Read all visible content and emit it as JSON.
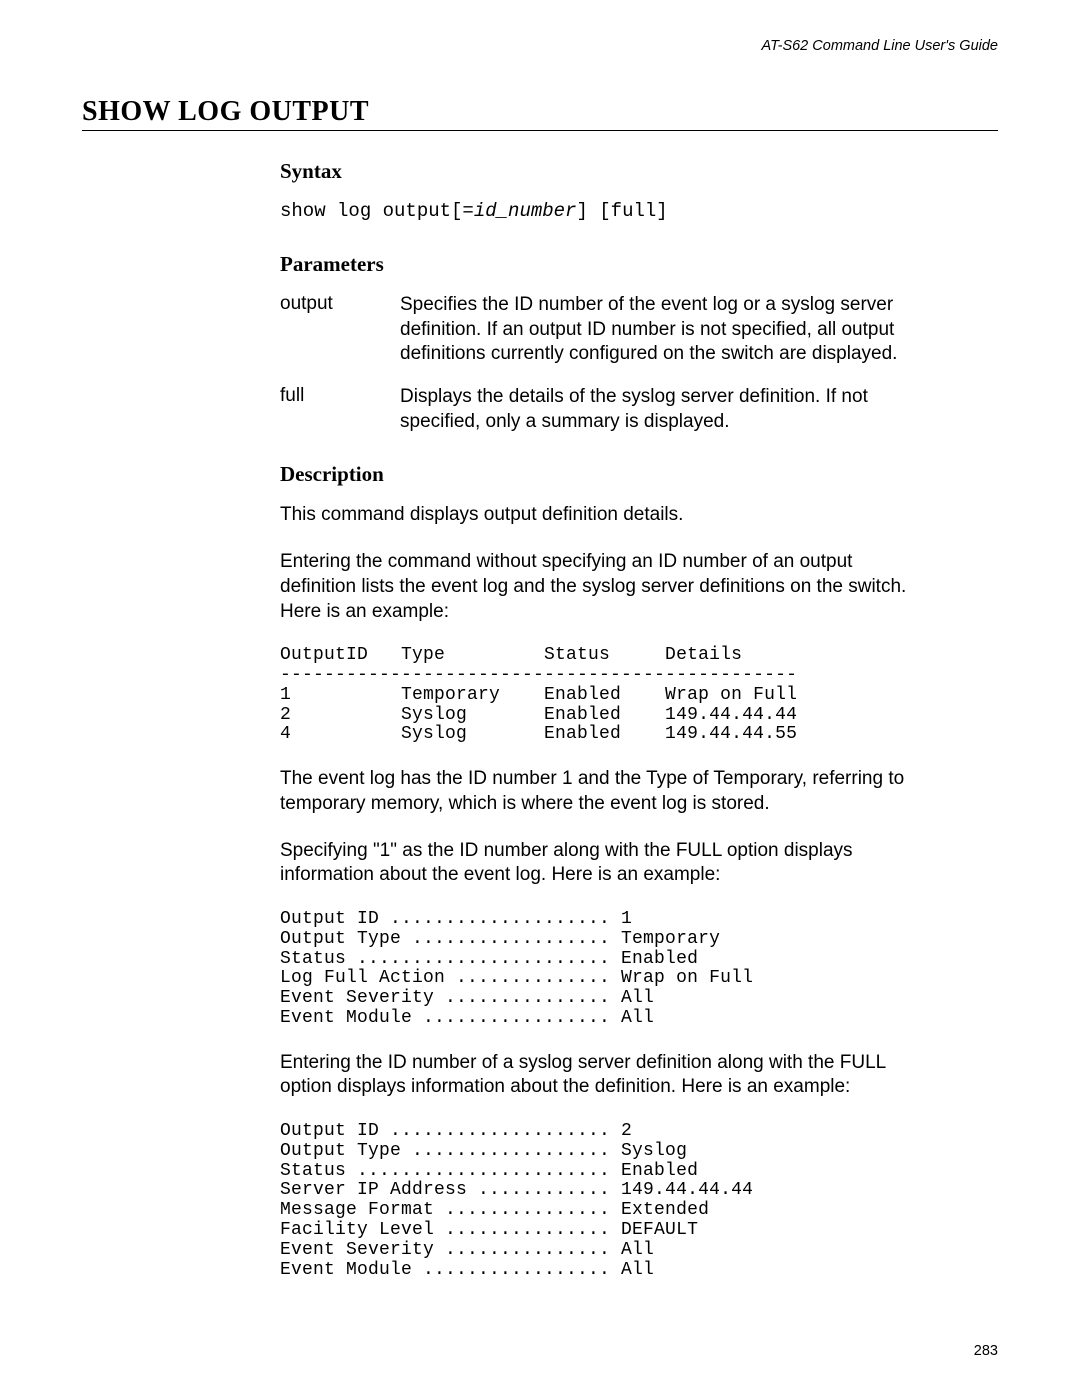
{
  "header": {
    "running_title": "AT-S62 Command Line User's Guide"
  },
  "title": "SHOW LOG OUTPUT",
  "syntax": {
    "heading": "Syntax",
    "line_prefix": "show log output[=",
    "line_var": "id_number",
    "line_suffix": "] [full]"
  },
  "parameters": {
    "heading": "Parameters",
    "items": [
      {
        "name": "output",
        "desc": "Specifies the ID number of the event log or a syslog server definition. If an output ID number is not specified, all output definitions currently configured on the switch are displayed."
      },
      {
        "name": "full",
        "desc": "Displays the details of the syslog server definition. If not specified, only a summary is displayed."
      }
    ]
  },
  "description": {
    "heading": "Description",
    "para1": "This command displays output definition details.",
    "para2": "Entering the command without specifying an ID number of an output definition lists the event log and the syslog server definitions on the switch. Here is an example:",
    "table1": "OutputID   Type         Status     Details\n-----------------------------------------------\n1          Temporary    Enabled    Wrap on Full\n2          Syslog       Enabled    149.44.44.44\n4          Syslog       Enabled    149.44.44.55",
    "para3": "The event log has the ID number 1 and the Type of Temporary, referring to temporary memory, which is where the event log is stored.",
    "para4": "Specifying \"1\" as the ID number along with the FULL option displays information about the event log. Here is an example:",
    "block2": "Output ID .................... 1\nOutput Type .................. Temporary\nStatus ....................... Enabled\nLog Full Action .............. Wrap on Full\nEvent Severity ............... All\nEvent Module ................. All",
    "para5": "Entering the ID number of a syslog server definition along with the FULL option displays information about the definition. Here is an example:",
    "block3": "Output ID .................... 2\nOutput Type .................. Syslog\nStatus ....................... Enabled\nServer IP Address ............ 149.44.44.44\nMessage Format ............... Extended\nFacility Level ............... DEFAULT\nEvent Severity ............... All\nEvent Module ................. All"
  },
  "page_number": "283"
}
